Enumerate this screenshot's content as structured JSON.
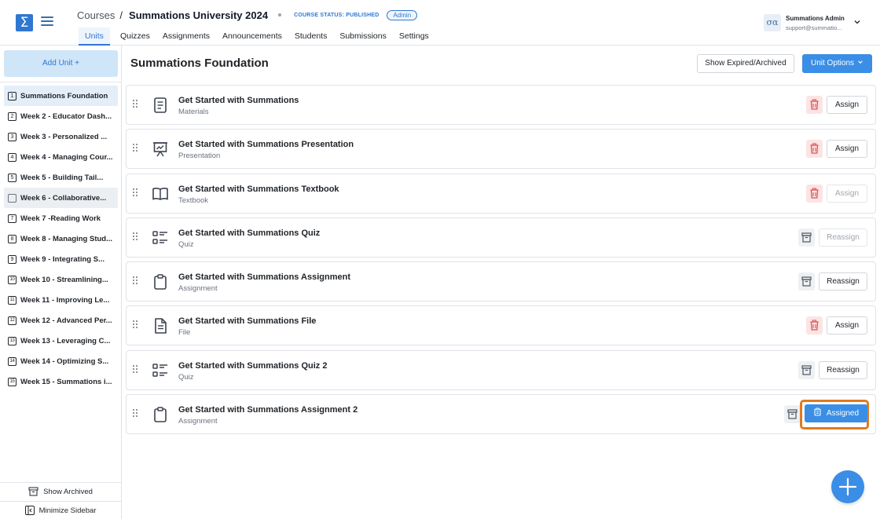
{
  "header": {
    "logo_glyph": "Σ",
    "breadcrumb_root": "Courses",
    "breadcrumb_sep": "/",
    "course_name": "Summations University 2024",
    "course_status": "COURSE STATUS: PUBLISHED",
    "role_badge": "Admin",
    "tabs": [
      {
        "label": "Units",
        "active": true
      },
      {
        "label": "Quizzes"
      },
      {
        "label": "Assignments"
      },
      {
        "label": "Announcements"
      },
      {
        "label": "Students"
      },
      {
        "label": "Submissions"
      },
      {
        "label": "Settings"
      }
    ],
    "user": {
      "avatar": "σα",
      "name": "Summations Admin",
      "email": "support@summatio..."
    }
  },
  "sidebar": {
    "add_unit_label": "Add Unit +",
    "units": [
      {
        "num": "1",
        "label": "Summations Foundation",
        "active": true
      },
      {
        "num": "2",
        "label": "Week 2 - Educator Dash..."
      },
      {
        "num": "3",
        "label": "Week 3 - Personalized ..."
      },
      {
        "num": "4",
        "label": "Week 4 - Managing Cour..."
      },
      {
        "num": "5",
        "label": "Week 5 - Building Tail..."
      },
      {
        "num": "",
        "label": "Week 6 - Collaborative...",
        "hover": true
      },
      {
        "num": "7",
        "label": "Week 7 -Reading Work"
      },
      {
        "num": "8",
        "label": "Week 8 - Managing Stud..."
      },
      {
        "num": "9",
        "label": "Week 9 - Integrating S..."
      },
      {
        "num": "10",
        "label": "Week 10 - Streamlining..."
      },
      {
        "num": "11",
        "label": "Week 11 - Improving Le..."
      },
      {
        "num": "12",
        "label": "Week 12 - Advanced Per..."
      },
      {
        "num": "13",
        "label": "Week 13 - Leveraging C..."
      },
      {
        "num": "14",
        "label": "Week 14 - Optimizing S..."
      },
      {
        "num": "15",
        "label": "Week 15 - Summations i..."
      }
    ],
    "show_archived_label": "Show Archived",
    "minimize_label": "Minimize Sidebar"
  },
  "main": {
    "title": "Summations Foundation",
    "show_expired_label": "Show Expired/Archived",
    "unit_options_label": "Unit Options",
    "items": [
      {
        "title": "Get Started with Summations",
        "type": "Materials",
        "icon": "document-icon",
        "action_icon": "trash",
        "action": "Assign",
        "disabled": false
      },
      {
        "title": "Get Started with Summations Presentation",
        "type": "Presentation",
        "icon": "presentation-icon",
        "action_icon": "trash",
        "action": "Assign",
        "disabled": false
      },
      {
        "title": "Get Started with Summations Textbook",
        "type": "Textbook",
        "icon": "book-icon",
        "action_icon": "trash",
        "action": "Assign",
        "disabled": true
      },
      {
        "title": "Get Started with Summations Quiz",
        "type": "Quiz",
        "icon": "quiz-icon",
        "action_icon": "archive",
        "action": "Reassign",
        "disabled": true
      },
      {
        "title": "Get Started with Summations Assignment",
        "type": "Assignment",
        "icon": "clipboard-icon",
        "action_icon": "archive",
        "action": "Reassign",
        "disabled": false
      },
      {
        "title": "Get Started with Summations File",
        "type": "File",
        "icon": "file-icon",
        "action_icon": "trash",
        "action": "Assign",
        "disabled": false
      },
      {
        "title": "Get Started with Summations Quiz 2",
        "type": "Quiz",
        "icon": "quiz-icon",
        "action_icon": "archive",
        "action": "Reassign",
        "disabled": false
      },
      {
        "title": "Get Started with Summations Assignment 2",
        "type": "Assignment",
        "icon": "clipboard-icon",
        "action_icon": "archive",
        "action": "Assigned",
        "highlighted": true
      }
    ]
  },
  "colors": {
    "primary": "#3a8ee6",
    "highlight_ring": "#e07a1f",
    "danger_bg": "#fbe4e4",
    "danger_icon": "#e05252"
  }
}
